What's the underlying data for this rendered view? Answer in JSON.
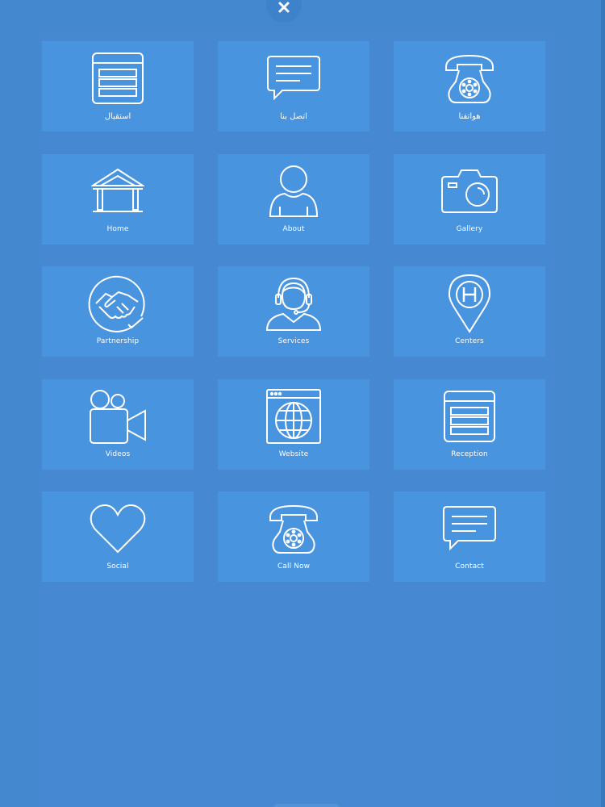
{
  "close_button": {
    "icon": "close-icon"
  },
  "tiles": [
    {
      "label": "استقبال",
      "icon": "reception-icon"
    },
    {
      "label": "اتصل بنا",
      "icon": "chat-bubble-icon"
    },
    {
      "label": "هواتفنا",
      "icon": "telephone-icon"
    },
    {
      "label": "Home",
      "icon": "house-icon"
    },
    {
      "label": "About",
      "icon": "person-icon"
    },
    {
      "label": "Gallery",
      "icon": "camera-icon"
    },
    {
      "label": "Partnership",
      "icon": "handshake-icon"
    },
    {
      "label": "Services",
      "icon": "headset-agent-icon"
    },
    {
      "label": "Centers",
      "icon": "map-pin-h-icon"
    },
    {
      "label": "Videos",
      "icon": "video-camera-icon"
    },
    {
      "label": "Website",
      "icon": "globe-browser-icon"
    },
    {
      "label": "Reception",
      "icon": "reception-icon"
    },
    {
      "label": "Social",
      "icon": "heart-icon"
    },
    {
      "label": "Call Now",
      "icon": "telephone-icon"
    },
    {
      "label": "Contact",
      "icon": "chat-bubble-icon"
    }
  ],
  "colors": {
    "background": "#4488d0",
    "tile": "#4994de",
    "icon_stroke": "#ffffff"
  }
}
